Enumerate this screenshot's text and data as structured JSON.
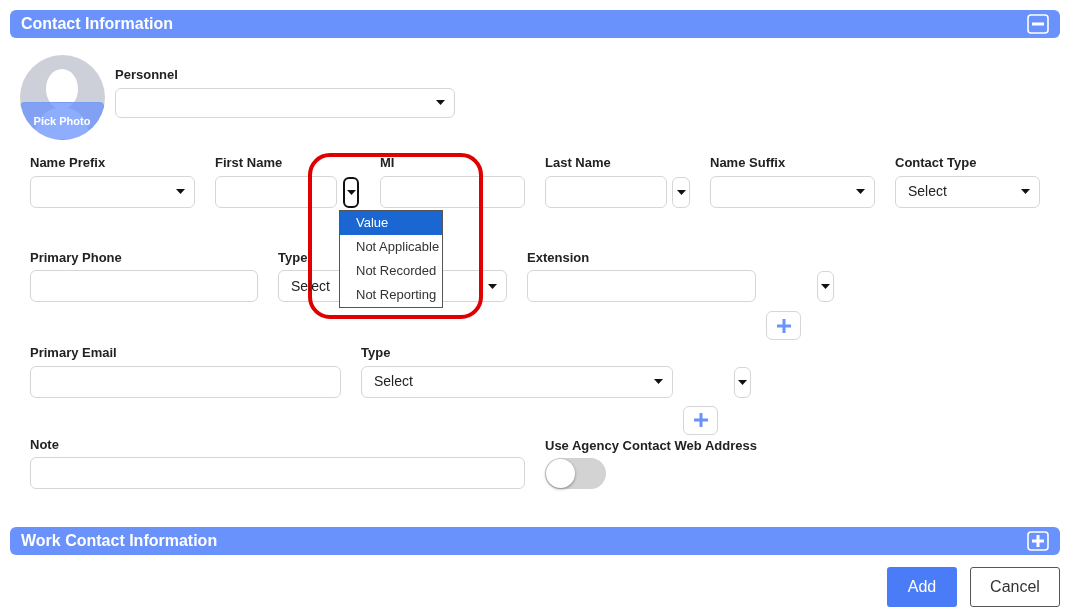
{
  "sections": [
    {
      "title": "Contact Information",
      "expanded": true
    },
    {
      "title": "Work Contact Information",
      "expanded": false
    }
  ],
  "photo": {
    "button": "Pick Photo"
  },
  "personnel": {
    "label": "Personnel"
  },
  "rows": [
    [
      {
        "kind": "select",
        "label": "Name Prefix"
      },
      {
        "kind": "text",
        "label": "First Name"
      },
      {
        "kind": "qualifier",
        "open": true,
        "options": [
          {
            "label": "Value",
            "selected": true
          },
          {
            "label": "Not Applicable",
            "selected": false
          },
          {
            "label": "Not Recorded",
            "selected": false
          },
          {
            "label": "Not Reporting",
            "selected": false
          }
        ]
      },
      {
        "kind": "text",
        "label": "MI"
      },
      {
        "kind": "text",
        "label": "Last Name"
      },
      {
        "kind": "qualifier",
        "open": false
      },
      {
        "kind": "select",
        "label": "Name Suffix"
      },
      {
        "kind": "select",
        "label": "Contact Type",
        "value": "Select"
      }
    ],
    [
      {
        "kind": "text",
        "label": "Primary Phone"
      },
      {
        "kind": "select",
        "label": "Type",
        "value": "Select"
      },
      {
        "kind": "text",
        "label": "Extension"
      },
      {
        "kind": "qualifier",
        "open": false
      }
    ],
    [
      {
        "kind": "add"
      }
    ],
    [
      {
        "kind": "text",
        "label": "Primary Email"
      },
      {
        "kind": "select",
        "label": "Type",
        "value": "Select"
      },
      {
        "kind": "qualifier",
        "open": false
      }
    ],
    [
      {
        "kind": "add"
      }
    ],
    [
      {
        "kind": "text",
        "label": "Note"
      },
      {
        "kind": "toggle",
        "label": "Use Agency Contact Web Address",
        "on": false
      }
    ]
  ],
  "buttons": [
    {
      "label": "Add",
      "kind": "primary"
    },
    {
      "label": "Cancel",
      "kind": "secondary"
    }
  ]
}
